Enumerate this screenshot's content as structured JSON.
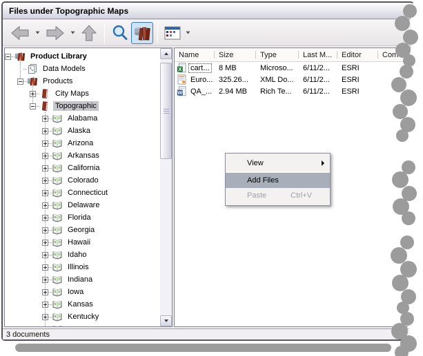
{
  "window_title": "Files under Topographic Maps",
  "toolbar": {
    "back": {
      "icon": "back-arrow-icon"
    },
    "back_dropdown": {
      "icon": "dropdown-caret-icon"
    },
    "forward": {
      "icon": "forward-arrow-icon"
    },
    "forward_dropdown": {
      "icon": "dropdown-caret-icon"
    },
    "up": {
      "icon": "up-arrow-icon"
    },
    "search": {
      "icon": "search-icon"
    },
    "library": {
      "icon": "product-library-icon",
      "pressed": true
    },
    "view_mode": {
      "icon": "details-view-icon"
    },
    "view_mode_dropdown": {
      "icon": "dropdown-caret-icon"
    }
  },
  "tree": {
    "items": [
      {
        "label": "Product Library",
        "level": 0,
        "expander": "minus",
        "icon": "library-books-icon",
        "bold": true
      },
      {
        "label": "Data Models",
        "level": 1,
        "expander": null,
        "icon": "data-models-icon"
      },
      {
        "label": "Products",
        "level": 1,
        "expander": "minus",
        "icon": "products-books-icon"
      },
      {
        "label": "City Maps",
        "level": 2,
        "expander": "plus",
        "icon": "product-book-icon"
      },
      {
        "label": "Topographic",
        "level": 2,
        "expander": "minus",
        "icon": "product-book-icon",
        "selected": true
      },
      {
        "label": "Alabama",
        "level": 3,
        "expander": "plus",
        "icon": "state-solution-icon"
      },
      {
        "label": "Alaska",
        "level": 3,
        "expander": "plus",
        "icon": "state-solution-icon"
      },
      {
        "label": "Arizona",
        "level": 3,
        "expander": "plus",
        "icon": "state-solution-icon"
      },
      {
        "label": "Arkansas",
        "level": 3,
        "expander": "plus",
        "icon": "state-solution-icon"
      },
      {
        "label": "California",
        "level": 3,
        "expander": "plus",
        "icon": "state-solution-icon"
      },
      {
        "label": "Colorado",
        "level": 3,
        "expander": "plus",
        "icon": "state-solution-icon"
      },
      {
        "label": "Connecticut",
        "level": 3,
        "expander": "plus",
        "icon": "state-solution-icon"
      },
      {
        "label": "Delaware",
        "level": 3,
        "expander": "plus",
        "icon": "state-solution-icon"
      },
      {
        "label": "Florida",
        "level": 3,
        "expander": "plus",
        "icon": "state-solution-icon"
      },
      {
        "label": "Georgia",
        "level": 3,
        "expander": "plus",
        "icon": "state-solution-icon"
      },
      {
        "label": "Hawaii",
        "level": 3,
        "expander": "plus",
        "icon": "state-solution-icon"
      },
      {
        "label": "Idaho",
        "level": 3,
        "expander": "plus",
        "icon": "state-solution-icon"
      },
      {
        "label": "Illinois",
        "level": 3,
        "expander": "plus",
        "icon": "state-solution-icon"
      },
      {
        "label": "Indiana",
        "level": 3,
        "expander": "plus",
        "icon": "state-solution-icon"
      },
      {
        "label": "Iowa",
        "level": 3,
        "expander": "plus",
        "icon": "state-solution-icon"
      },
      {
        "label": "Kansas",
        "level": 3,
        "expander": "plus",
        "icon": "state-solution-icon"
      },
      {
        "label": "Kentucky",
        "level": 3,
        "expander": "plus",
        "icon": "state-solution-icon"
      },
      {
        "label": "",
        "level": 3,
        "expander": "plus",
        "icon": "state-solution-icon",
        "partial": true
      }
    ]
  },
  "file_list": {
    "columns": [
      {
        "label": "Name"
      },
      {
        "label": "Size"
      },
      {
        "label": "Type"
      },
      {
        "label": "Last M..."
      },
      {
        "label": "Editor"
      },
      {
        "label": "Com"
      }
    ],
    "rows": [
      {
        "icon": "excel-file-icon",
        "name": "cart...",
        "size": "8 MB",
        "type": "Microso...",
        "last_modified": "6/11/2...",
        "editor": "ESRI",
        "focused": true
      },
      {
        "icon": "xml-file-icon",
        "name": "Euro...",
        "size": "325.26...",
        "type": "XML Do...",
        "last_modified": "6/11/2...",
        "editor": "ESRI"
      },
      {
        "icon": "word-file-icon",
        "name": "QA_...",
        "size": "2.94 MB",
        "type": "Rich Te...",
        "last_modified": "6/11/2...",
        "editor": "ESRI"
      }
    ]
  },
  "context_menu": {
    "items": [
      {
        "label": "View",
        "submenu": true
      },
      {
        "separator": true
      },
      {
        "label": "Add Files",
        "highlighted": true
      },
      {
        "label": "Paste",
        "shortcut": "Ctrl+V",
        "disabled": true
      }
    ]
  },
  "status_bar": {
    "text": "3 documents"
  },
  "colors": {
    "selection_gray": "#c6c6cc",
    "menu_highlight": "#a9aebb",
    "book_maroon": "#8d3524",
    "accent_blue": "#3a77c2",
    "torn_gray": "#9c9c9c"
  }
}
